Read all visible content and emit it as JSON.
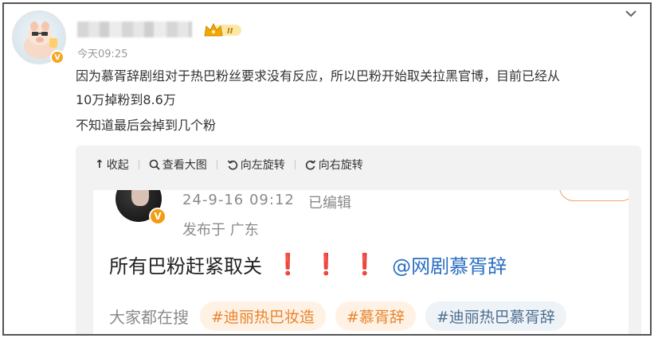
{
  "post": {
    "time": "今天09:25",
    "text_line1": "因为慕胥辞剧组对于热巴粉丝要求没有反应，所以巴粉开始取关拉黑官博，目前已经从",
    "text_line2": "10万掉粉到8.6万",
    "text_line3": "不知道最后会掉到几个粉",
    "rank_badge": "II"
  },
  "toolbar": {
    "collapse_label": "收起",
    "view_large_label": "查看大图",
    "rotate_left_label": "向左旋转",
    "rotate_right_label": "向右旋转"
  },
  "screenshot": {
    "date": "24-9-16 09:12",
    "edited": "已编辑",
    "location": "发布于 广东",
    "content": "所有巴粉赶紧取关",
    "bangs": [
      "❗",
      "❗",
      "❗"
    ],
    "mention": "@网剧慕胥辞",
    "search_label": "大家都在搜",
    "tags": [
      "#迪丽热巴妆造",
      "#慕胥辞",
      "#迪丽热巴慕胥辞"
    ]
  },
  "colors": {
    "accent_orange": "#e7842e",
    "mention_blue": "#2a6ec2",
    "bang_red": "#e0242c",
    "badge_gold": "#f5a623"
  }
}
